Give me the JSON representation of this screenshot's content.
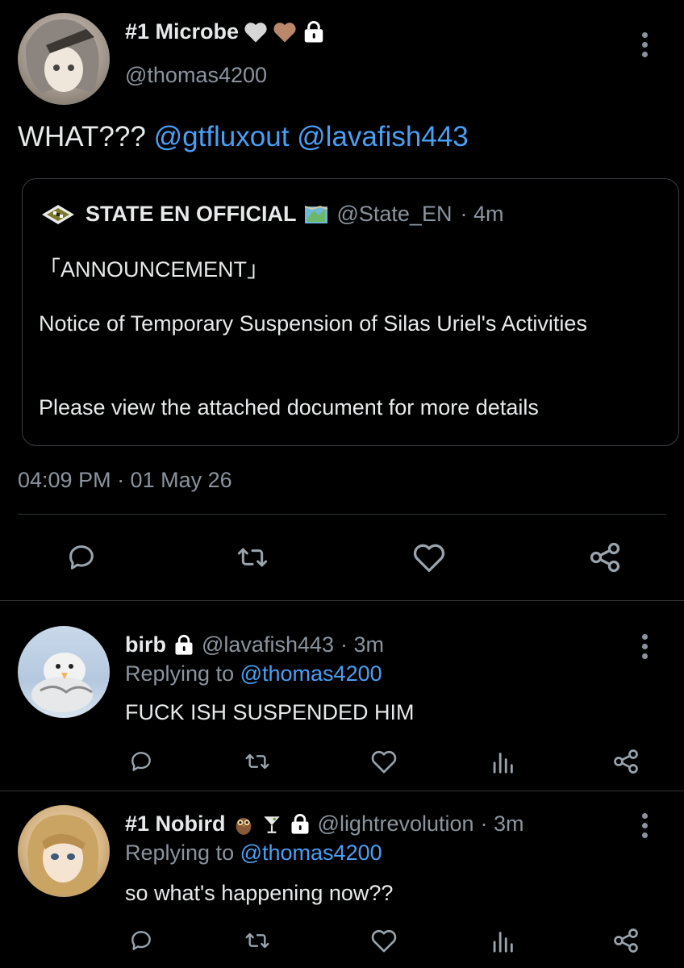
{
  "main_tweet": {
    "display_name": "#1 Microbe",
    "badges": [
      "white-heart",
      "brown-heart",
      "lock-icon"
    ],
    "handle": "@thomas4200",
    "text_prefix": "WHAT???",
    "mentions": [
      "@gtfluxout",
      "@lavafish443"
    ],
    "quote": {
      "display_name": "STATE EN OFFICIAL",
      "handle": "@State_EN",
      "time": "· 4m",
      "line1": "「ANNOUNCEMENT」",
      "line2": "Notice of Temporary Suspension of Silas Uriel's Activities",
      "line3": "Please view the attached document for more details"
    },
    "timestamp": "04:09 PM · 01 May 26"
  },
  "replies": [
    {
      "display_name": "birb",
      "handle": "@lavafish443",
      "time": "· 3m",
      "replying_prefix": "Replying to",
      "replying_to": "@thomas4200",
      "text": "FUCK ISH SUSPENDED HIM"
    },
    {
      "display_name": "#1 Nobird",
      "handle": "@lightrevolution",
      "time": "· 3m",
      "replying_prefix": "Replying to",
      "replying_to": "@thomas4200",
      "text": "so what's happening now??"
    }
  ],
  "colors": {
    "accent": "#4a9ff5",
    "muted": "#8b949e",
    "background": "#000000",
    "border": "#2f3336"
  }
}
